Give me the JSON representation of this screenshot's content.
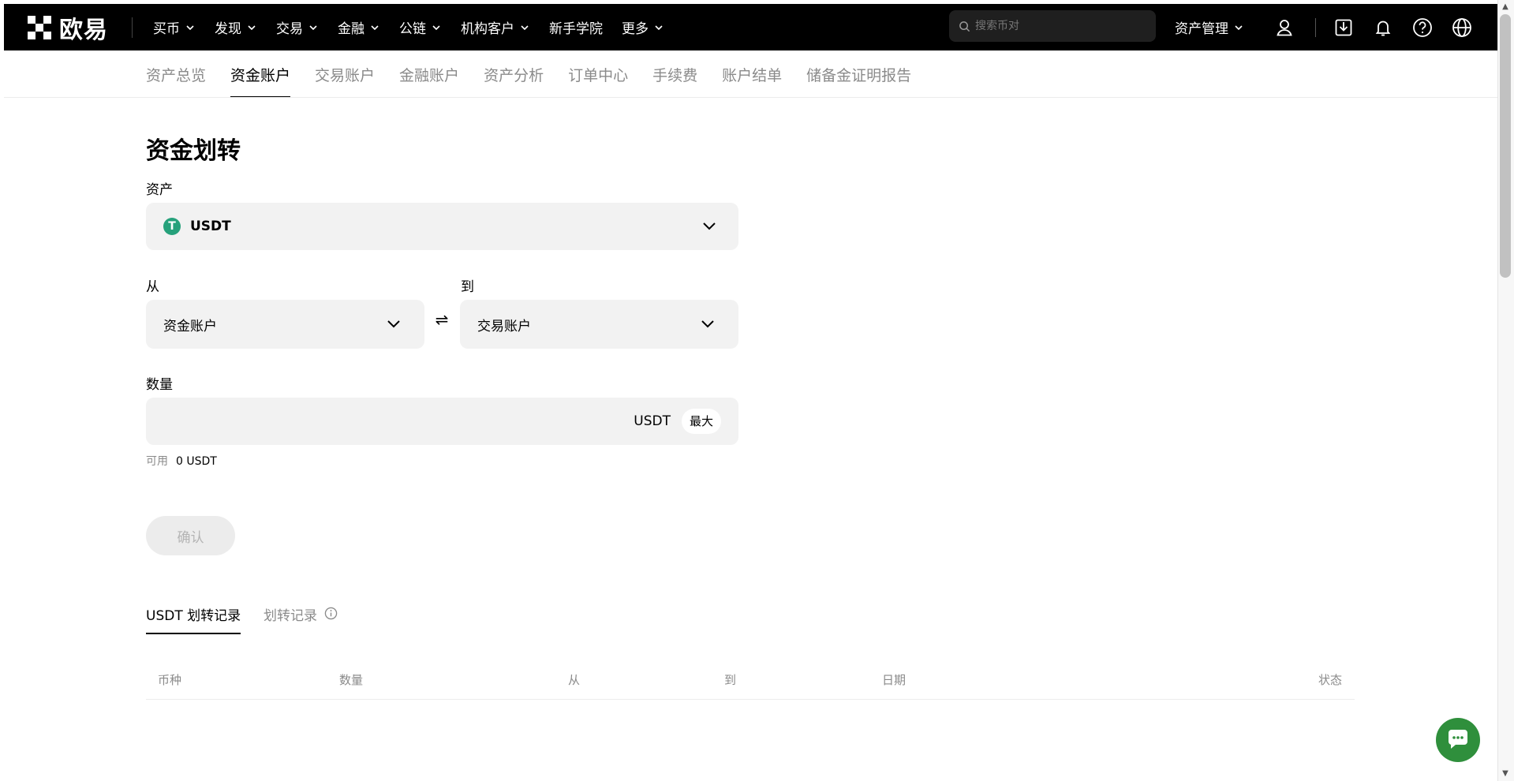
{
  "brand": {
    "logo_text": "欧易"
  },
  "nav": {
    "items": [
      {
        "label": "买币",
        "dropdown": true
      },
      {
        "label": "发现",
        "dropdown": true
      },
      {
        "label": "交易",
        "dropdown": true
      },
      {
        "label": "金融",
        "dropdown": true
      },
      {
        "label": "公链",
        "dropdown": true
      },
      {
        "label": "机构客户",
        "dropdown": true
      },
      {
        "label": "新手学院",
        "dropdown": false
      },
      {
        "label": "更多",
        "dropdown": true
      }
    ],
    "search_placeholder": "搜索币对",
    "asset_mgmt_label": "资产管理",
    "icons": [
      "user-icon",
      "download-icon",
      "bell-icon",
      "help-icon",
      "globe-icon"
    ]
  },
  "subtabs": {
    "items": [
      "资产总览",
      "资金账户",
      "交易账户",
      "金融账户",
      "资产分析",
      "订单中心",
      "手续费",
      "账户结单",
      "储备金证明报告"
    ],
    "active": "资金账户"
  },
  "transfer": {
    "title": "资金划转",
    "asset_label": "资产",
    "asset_value": "USDT",
    "asset_icon_letter": "T",
    "from_label": "从",
    "from_value": "资金账户",
    "to_label": "到",
    "to_value": "交易账户",
    "swap_symbol": "⇌",
    "amount_label": "数量",
    "amount_value": "",
    "amount_unit": "USDT",
    "max_label": "最大",
    "available_label": "可用",
    "available_value": "0 USDT",
    "confirm_label": "确认"
  },
  "records": {
    "tabs": [
      "USDT 划转记录",
      "划转记录"
    ],
    "active": "USDT 划转记录",
    "columns": [
      "币种",
      "数量",
      "从",
      "到",
      "日期",
      "状态"
    ]
  },
  "colors": {
    "nav_bg": "#000000",
    "field_bg": "#f2f2f2",
    "usdt_green": "#26a17b",
    "muted_text": "#8a8a8a"
  }
}
